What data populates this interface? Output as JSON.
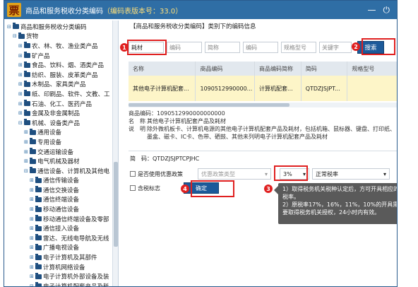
{
  "window": {
    "logo_char": "票",
    "title": "商品和服务税收分类编码",
    "version": "（编码表版本号：33.0）",
    "minimize": "—",
    "close": "⏻"
  },
  "tree": {
    "items": [
      {
        "label": "商品和服务税收分类编码",
        "indent": 0,
        "toggle": "⊟"
      },
      {
        "label": "货物",
        "indent": 1,
        "toggle": "⊟"
      },
      {
        "label": "农、林、牧、渔业类产品",
        "indent": 2,
        "toggle": "⊞"
      },
      {
        "label": "矿产品",
        "indent": 2,
        "toggle": "⊞"
      },
      {
        "label": "食品、饮料、烟、酒类产品",
        "indent": 2,
        "toggle": "⊞"
      },
      {
        "label": "纺织、服装、皮革类产品",
        "indent": 2,
        "toggle": "⊞"
      },
      {
        "label": "木制品、家具类产品",
        "indent": 2,
        "toggle": "⊞"
      },
      {
        "label": "纸、印刷品、软件、文教、工",
        "indent": 2,
        "toggle": "⊞"
      },
      {
        "label": "石油、化工、医药产品",
        "indent": 2,
        "toggle": "⊞"
      },
      {
        "label": "金属及非金属制品",
        "indent": 2,
        "toggle": "⊞"
      },
      {
        "label": "机械、设备类产品",
        "indent": 2,
        "toggle": "⊟"
      },
      {
        "label": "通用设备",
        "indent": 3,
        "toggle": "⊞"
      },
      {
        "label": "专用设备",
        "indent": 3,
        "toggle": "⊞"
      },
      {
        "label": "交通运输设备",
        "indent": 3,
        "toggle": "⊞"
      },
      {
        "label": "电气机械及器材",
        "indent": 3,
        "toggle": "⊞"
      },
      {
        "label": "通信设备、计算机及其他电",
        "indent": 3,
        "toggle": "⊟"
      },
      {
        "label": "通信传输设备",
        "indent": 4,
        "toggle": "⊞"
      },
      {
        "label": "通信交换设备",
        "indent": 4,
        "toggle": "⊞"
      },
      {
        "label": "通信终端设备",
        "indent": 4,
        "toggle": "⊞"
      },
      {
        "label": "移动通信设备",
        "indent": 4,
        "toggle": "⊞"
      },
      {
        "label": "移动通信终端设备及零部",
        "indent": 4,
        "toggle": "⊞"
      },
      {
        "label": "通信接入设备",
        "indent": 4,
        "toggle": "⊞"
      },
      {
        "label": "雷达、无线电导航及无线",
        "indent": 4,
        "toggle": "⊞"
      },
      {
        "label": "广播电视设备",
        "indent": 4,
        "toggle": "⊞"
      },
      {
        "label": "电子计算机及其部件",
        "indent": 4,
        "toggle": "⊞"
      },
      {
        "label": "计算机网络设备",
        "indent": 4,
        "toggle": "⊞"
      },
      {
        "label": "电子计算机外部设备及装",
        "indent": 4,
        "toggle": "⊞"
      },
      {
        "label": "电子计算机配套产品及耗",
        "indent": 4,
        "toggle": "⊟"
      }
    ]
  },
  "header": {
    "breadcrumb": "【商品和服务税收分类编码】类别下的编码信息"
  },
  "search": {
    "name_value": "耗材",
    "code_placeholder": "编码",
    "short_placeholder": "简称",
    "code2_placeholder": "编码",
    "model_placeholder": "规格型号",
    "keyword_placeholder": "关键字",
    "search_label": "搜索"
  },
  "table": {
    "columns": [
      "名称",
      "商品编码",
      "商品编码简称",
      "简码",
      "规格型号"
    ],
    "row": [
      "其他电子计算机配套...",
      "1090512990000...",
      "计算机配套...",
      "QTDZJSJPT...",
      ""
    ]
  },
  "detail": {
    "code_line": "商品编码：1090512990000000000",
    "name_label": "名　称",
    "name_value": "其他电子计算机配套产品及耗材",
    "desc_label": "说　明",
    "desc_value": "除外微机板卡、计算机电源的其他电子计算机配套产品及耗材，包括机箱、鼠标器、键盘、打印纸、墨盒、磁卡、IC卡、色带、硒鼓、其他未列明电子计算机配套产品及耗材",
    "jm_line": "简　码：QTDZJSJPTCPJHC"
  },
  "options": {
    "preferential_label": "是否使用优惠政策",
    "policy_placeholder": "优惠政策类型",
    "tax_rate": "3%",
    "tax_type": "正常税率",
    "tax_included_label": "含税标志",
    "confirm_label": "确定"
  },
  "tooltip": {
    "line1": "1）取得税务机关税种认定后，方可开具相应的税率。",
    "line2": "2）原税率17%，16%，11%，10%的开具需要取得税务机关授权，24小时内有效。"
  },
  "badges": {
    "b1": "1",
    "b2": "2",
    "b3": "3",
    "b4": "4"
  },
  "colors": {
    "title_bar": "#2f6ea5",
    "accent": "#1c5a9a",
    "highlight": "#e02020"
  }
}
